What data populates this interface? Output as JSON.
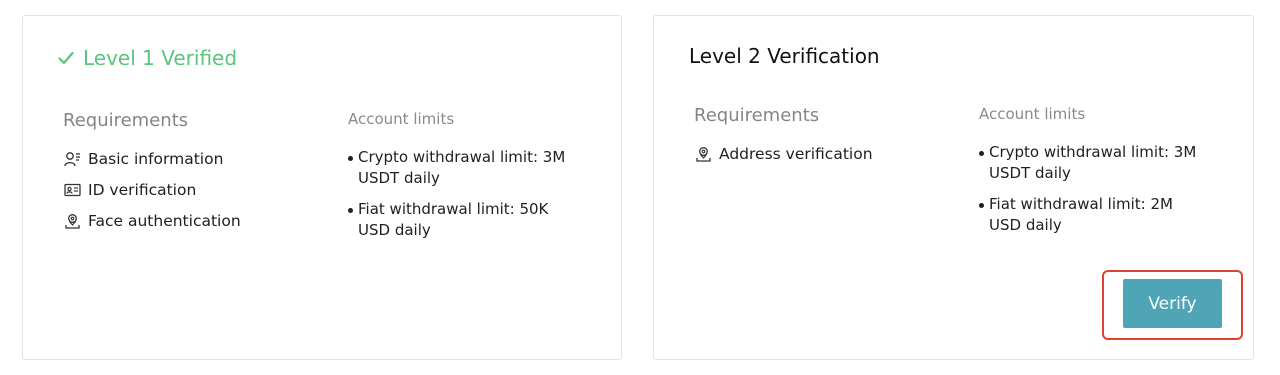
{
  "level1": {
    "title": "Level 1 Verified",
    "requirements_label": "Requirements",
    "limits_label": "Account limits",
    "requirements": [
      {
        "icon": "user-info-icon",
        "label": "Basic information"
      },
      {
        "icon": "id-card-icon",
        "label": "ID verification"
      },
      {
        "icon": "face-location-icon",
        "label": "Face authentication"
      }
    ],
    "limits": [
      "Crypto withdrawal limit: 3M USDT daily",
      "Fiat withdrawal limit: 50K USD daily"
    ]
  },
  "level2": {
    "title": "Level 2 Verification",
    "requirements_label": "Requirements",
    "limits_label": "Account limits",
    "requirements": [
      {
        "icon": "location-pin-icon",
        "label": "Address verification"
      }
    ],
    "limits": [
      "Crypto withdrawal limit: 3M USDT daily",
      "Fiat withdrawal limit: 2M USD daily"
    ],
    "verify_label": "Verify"
  },
  "colors": {
    "verified_green": "#5ac47c",
    "button_teal": "#4fa4b6",
    "highlight_red": "#e0412f"
  }
}
